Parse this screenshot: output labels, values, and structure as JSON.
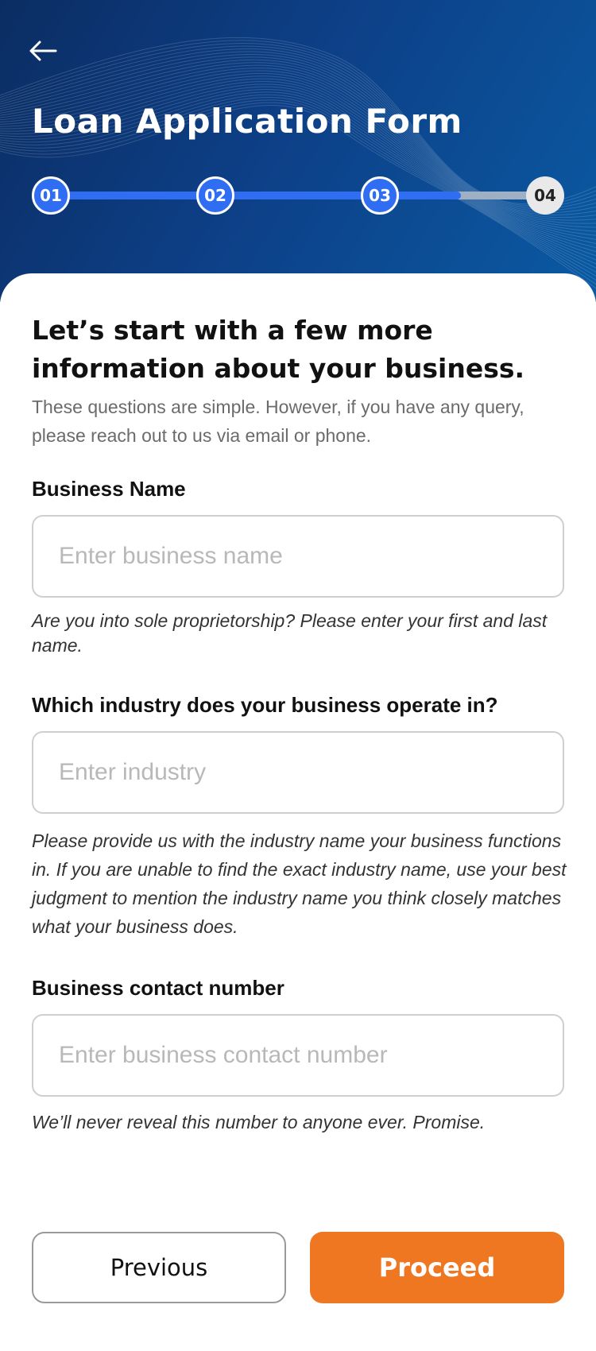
{
  "header": {
    "title": "Loan Application Form",
    "background_color": "#0d3f86"
  },
  "back_icon": "arrow-left-icon",
  "stepper": {
    "steps": [
      "01",
      "02",
      "03",
      "04"
    ],
    "completed_steps": 3,
    "current_step": 4,
    "progress_fraction": 0.83,
    "active_color": "#2f6ef2"
  },
  "intro": {
    "heading": "Let’s start with a few more information about your business.",
    "description": "These questions are simple. However, if you have any query, please reach out to us via email or phone."
  },
  "form": {
    "business_name": {
      "label": "Business Name",
      "placeholder": "Enter business name",
      "value": "",
      "hint": "Are you into sole proprietorship? Please enter your first and last name."
    },
    "industry": {
      "label": "Which industry does your business operate in?",
      "placeholder": "Enter industry",
      "value": "",
      "hint": "Please provide us with the industry name your business functions in. If you are unable to find the exact industry name, use your best judgment to mention the industry name you think closely matches what your business does."
    },
    "contact_number": {
      "label": "Business contact number",
      "placeholder": "Enter business contact number",
      "value": "",
      "hint": "We’ll never reveal this number to anyone ever. Promise."
    }
  },
  "actions": {
    "previous_label": "Previous",
    "proceed_label": "Proceed",
    "proceed_color": "#ef7722"
  }
}
